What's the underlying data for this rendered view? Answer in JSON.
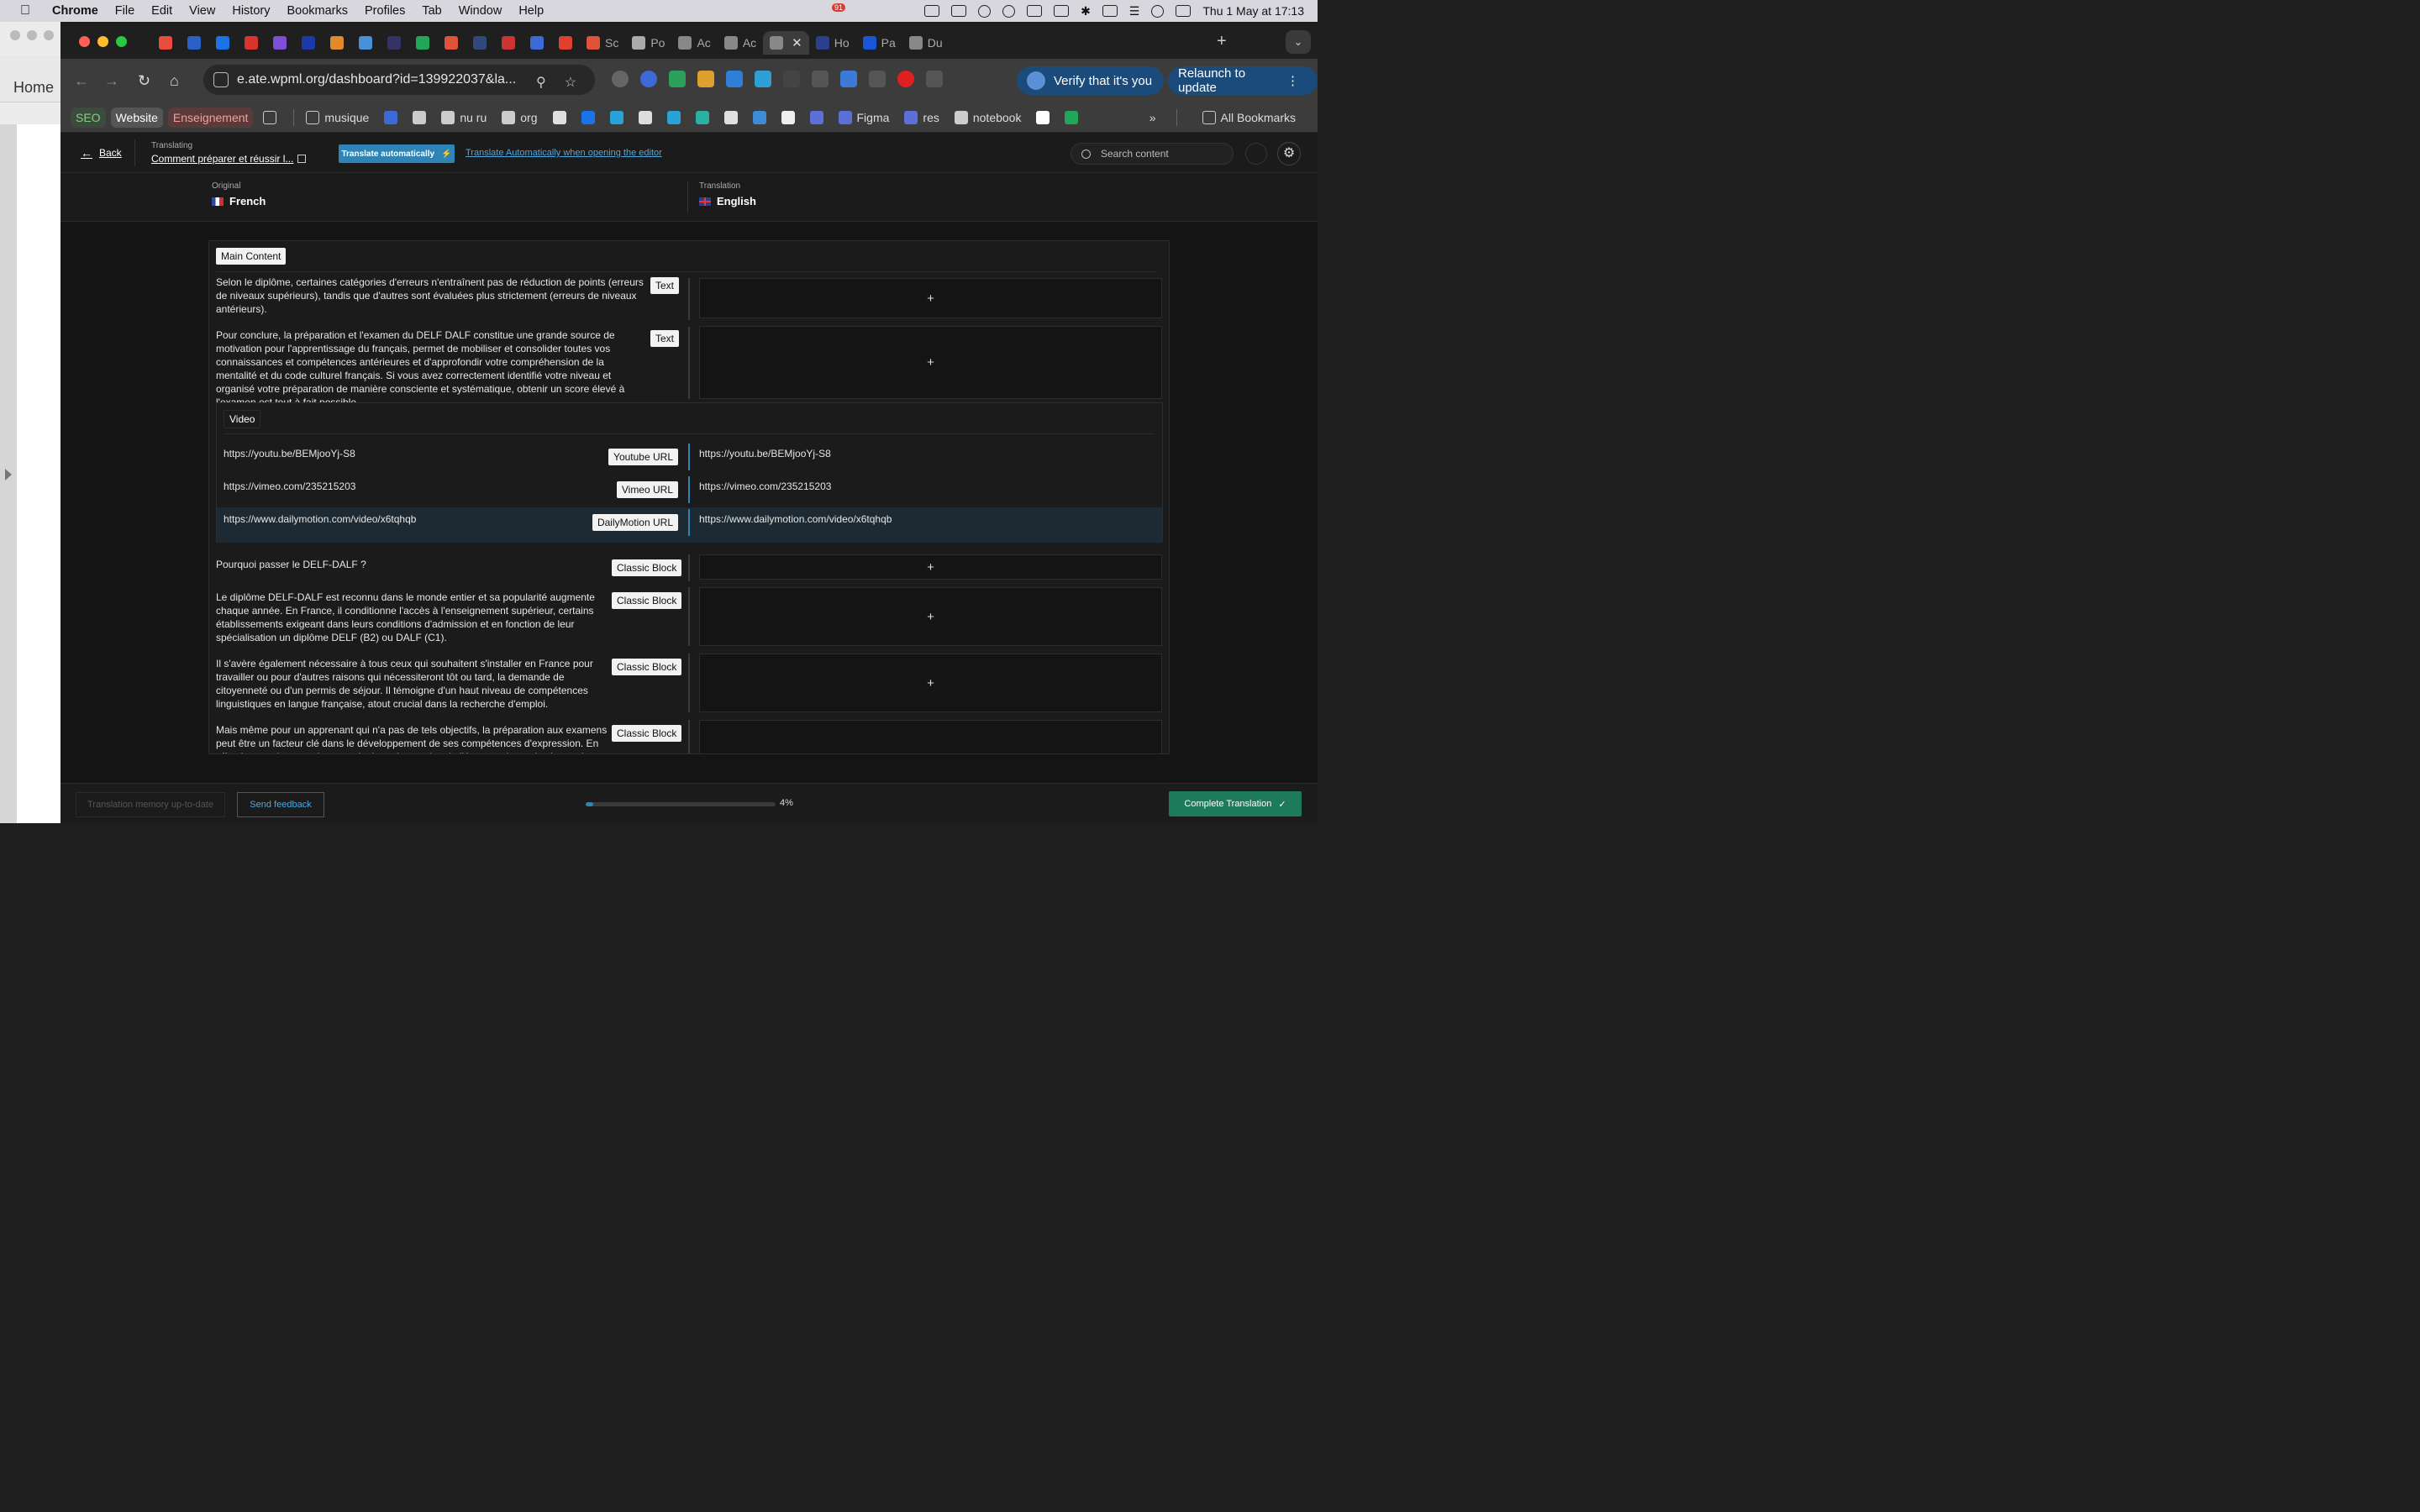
{
  "menubar": {
    "app": "Chrome",
    "items": [
      "File",
      "Edit",
      "View",
      "History",
      "Bookmarks",
      "Profiles",
      "Tab",
      "Window",
      "Help"
    ],
    "notification_count": "91",
    "datetime": "Thu 1 May at  17:13"
  },
  "background_window": {
    "home_label": "Home"
  },
  "tabs": [
    {
      "label": "",
      "color": "#e74c3c"
    },
    {
      "label": "",
      "color": "#2b61c6"
    },
    {
      "label": "",
      "color": "#1a73e8"
    },
    {
      "label": "",
      "color": "#d9342b"
    },
    {
      "label": "",
      "color": "#7b4fd6"
    },
    {
      "label": "",
      "color": "#1b3aa8"
    },
    {
      "label": "",
      "color": "#e08a2c"
    },
    {
      "label": "",
      "color": "#4a90d9"
    },
    {
      "label": "",
      "color": "#333366"
    },
    {
      "label": "",
      "color": "#22a65a"
    },
    {
      "label": "",
      "color": "#e0533a"
    },
    {
      "label": "",
      "color": "#2f4a7a"
    },
    {
      "label": "",
      "color": "#c33"
    },
    {
      "label": "",
      "color": "#3d6ad6"
    },
    {
      "label": "",
      "color": "#e0402f"
    },
    {
      "label": "Sc",
      "color": "#e0533a"
    },
    {
      "label": "Po",
      "color": "#aaaaaa"
    },
    {
      "label": "Ac",
      "color": "#888888"
    },
    {
      "label": "Ac",
      "color": "#888888"
    },
    {
      "label": "",
      "color": "#888888",
      "active": true
    },
    {
      "label": "Ho",
      "color": "#2b3f8f"
    },
    {
      "label": "Pa",
      "color": "#1a55d6"
    },
    {
      "label": "Du",
      "color": "#888888"
    }
  ],
  "toolbar": {
    "url": "e.ate.wpml.org/dashboard?id=139922037&la...",
    "verify_label": "Verify that it's you",
    "relaunch_label": "Relaunch to update",
    "ext_badge_1": "1",
    "ext_badge_2": "2"
  },
  "bookmarks": {
    "chips": [
      "SEO",
      "Website",
      "Enseignement"
    ],
    "items": [
      {
        "label": "musique",
        "icon": "folder-icon"
      },
      {
        "label": "",
        "icon": "diamond-icon",
        "color": "#3d6ad6"
      },
      {
        "label": "",
        "icon": "profile-icon",
        "color": "#cccccc"
      },
      {
        "label": "nu ru",
        "icon": "profile-icon",
        "color": "#cccccc"
      },
      {
        "label": "org",
        "icon": "wordpress-icon",
        "color": "#cccccc"
      },
      {
        "label": "",
        "icon": "site-icon",
        "color": "#e0e0e0"
      },
      {
        "label": "",
        "icon": "s-icon",
        "color": "#1a73e8"
      },
      {
        "label": "",
        "icon": "site-icon",
        "color": "#29a3d6"
      },
      {
        "label": "",
        "icon": "store-icon",
        "color": "#dddddd"
      },
      {
        "label": "",
        "icon": "cloud-icon",
        "color": "#29a3d6"
      },
      {
        "label": "",
        "icon": "chat-icon",
        "color": "#2ab0a0"
      },
      {
        "label": "",
        "icon": "infinity-icon",
        "color": "#e0e0e0"
      },
      {
        "label": "",
        "icon": "school-icon",
        "color": "#3d8ad6"
      },
      {
        "label": "",
        "icon": "site-icon",
        "color": "#eeeeee"
      },
      {
        "label": "",
        "icon": "link-icon",
        "color": "#5b6fd6"
      },
      {
        "label": "Figma",
        "icon": "link-icon",
        "color": "#5b6fd6"
      },
      {
        "label": "res",
        "icon": "link-icon",
        "color": "#5b6fd6"
      },
      {
        "label": "notebook",
        "icon": "notebook-icon",
        "color": "#cccccc"
      },
      {
        "label": "",
        "icon": "amazon-icon",
        "color": "#ffffff"
      },
      {
        "label": "",
        "icon": "chart-icon",
        "color": "#22a65a"
      }
    ],
    "all_bookmarks": "All Bookmarks"
  },
  "editor": {
    "back_label": "Back",
    "translating_label": "Translating",
    "translating_title": "Comment préparer et réussir l...",
    "translate_auto_btn": "Translate automatically",
    "translate_auto_link": "Translate Automatically when opening the editor",
    "search_placeholder": "Search content",
    "original_label": "Original",
    "original_lang": "French",
    "translation_label": "Translation",
    "translation_lang": "English",
    "section_title": "Main Content",
    "segments": [
      {
        "text": "Selon le diplôme, certaines catégories d'erreurs n'entraînent pas de réduction de points (erreurs de niveaux supérieurs), tandis que d'autres sont évaluées plus strictement (erreurs de niveaux antérieurs).",
        "type": "Text"
      },
      {
        "text": "Pour conclure, la préparation et l'examen du DELF DALF constitue une grande source de motivation pour l'apprentissage du français, permet de mobiliser et consolider toutes vos connaissances et compétences antérieures et d'approfondir votre compréhension de la mentalité et du code culturel français. Si vous avez correctement identifié votre niveau et organisé votre préparation de manière consciente et systématique, obtenir un score élevé à l'examen est tout à fait possible.",
        "type": "Text"
      }
    ],
    "video": {
      "title": "Video",
      "rows": [
        {
          "original": "https://youtu.be/BEMjooYj-S8",
          "type": "Youtube URL",
          "translation": "https://youtu.be/BEMjooYj-S8"
        },
        {
          "original": "https://vimeo.com/235215203",
          "type": "Vimeo URL",
          "translation": "https://vimeo.com/235215203"
        },
        {
          "original": "https://www.dailymotion.com/video/x6tqhqb",
          "type": "DailyMotion URL",
          "translation": "https://www.dailymotion.com/video/x6tqhqb"
        }
      ]
    },
    "classic_segments": [
      {
        "text": "Pourquoi passer le DELF-DALF ?",
        "type": "Classic Block"
      },
      {
        "text": "Le diplôme DELF-DALF est reconnu dans le monde entier et sa popularité augmente chaque année. En France, il conditionne l'accès à l'enseignement supérieur, certains établissements exigeant dans leurs conditions d'admission et en fonction de leur spécialisation un diplôme DELF (B2) ou DALF (C1).",
        "type": "Classic Block"
      },
      {
        "text": "Il s'avère également nécessaire à tous ceux qui souhaitent s'installer en France pour travailler ou pour d'autres raisons qui nécessiteront tôt ou tard, la demande de citoyenneté ou d'un permis de séjour. Il témoigne d'un haut niveau de compétences linguistiques en langue française, atout crucial dans la recherche d'emploi.",
        "type": "Classic Block"
      },
      {
        "text": "Mais même pour un apprenant qui n'a pas de tels objectifs, la préparation aux examens peut être un facteur clé dans le développement de ses compétences d'expression. En effet, lorsque les examinateurs évaluent les parties de l'épreuve de production orale et écrite, les",
        "type": "Classic Block"
      }
    ],
    "add_symbol": "+",
    "footer": {
      "memory_btn": "Translation memory up-to-date",
      "feedback_btn": "Send feedback",
      "progress": 0.04,
      "progress_label": "4%",
      "complete_btn": "Complete Translation"
    }
  }
}
